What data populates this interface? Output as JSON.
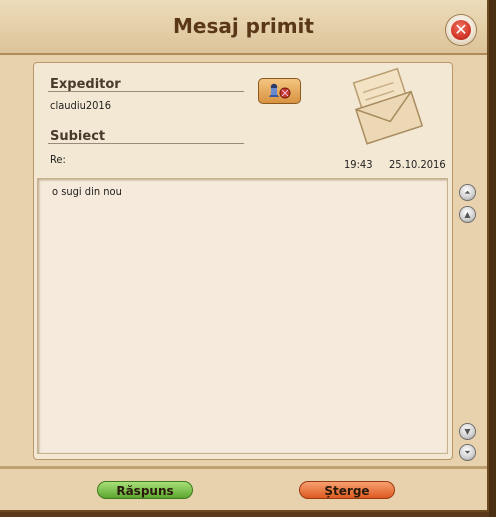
{
  "window": {
    "title": "Mesaj primit",
    "close_icon": "close-icon"
  },
  "message": {
    "sender_label": "Expeditor",
    "sender": "claudiu2016",
    "subject_label": "Subiect",
    "subject": "Re:",
    "time": "19:43",
    "date": "25.10.2016",
    "body": "o sugi din nou",
    "address_book_icon": "add-to-contacts-icon",
    "envelope_icon": "envelope-letter-icon"
  },
  "buttons": {
    "reply": "Răspuns",
    "delete": "Șterge"
  },
  "scroll": {
    "top_icon": "scroll-top-icon",
    "up_icon": "scroll-up-icon",
    "down_icon": "scroll-down-icon",
    "bottom_icon": "scroll-bottom-icon"
  },
  "colors": {
    "reply_button": "#5ca630",
    "delete_button": "#de5a22",
    "close_button": "#d43a2a",
    "title_text": "#5a3716"
  }
}
